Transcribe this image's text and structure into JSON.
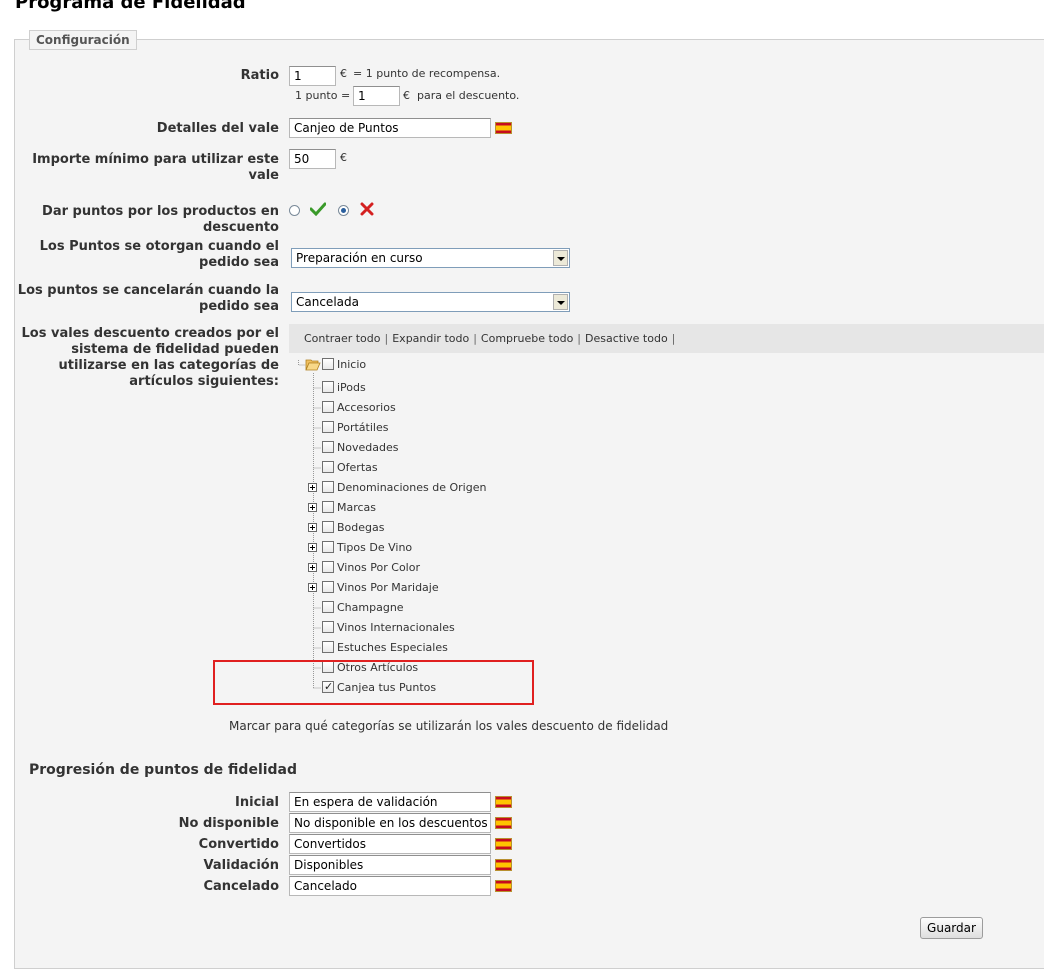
{
  "page_title": "Programa de Fidelidad",
  "config_legend": "Configuración",
  "ratio": {
    "label": "Ratio",
    "value": "1",
    "currency": "€",
    "suffix": "= 1 punto de recompensa.",
    "point_prefix": "1 punto =",
    "point_value": "1",
    "point_currency": "€",
    "point_suffix": "para el descuento."
  },
  "voucher_details": {
    "label": "Detalles del vale",
    "value": "Canjeo de Puntos"
  },
  "min_amount": {
    "label": "Importe mínimo para utilizar este vale",
    "value": "50",
    "currency": "€"
  },
  "discounted_products": {
    "label": "Dar puntos por los productos en descuento",
    "selected": "no"
  },
  "points_awarded": {
    "label": "Los Puntos se otorgan cuando el pedido sea",
    "selected": "Preparación en curso"
  },
  "points_cancelled": {
    "label": "Los puntos se cancelarán cuando la pedido sea",
    "selected": "Cancelada"
  },
  "categories": {
    "label": "Los vales descuento creados por el sistema de fidelidad pueden utilizarse en las categorías de artículos siguientes:",
    "toolbar": [
      "Contraer todo",
      "Expandir todo",
      "Compruebe todo",
      "Desactive todo"
    ],
    "root": "Inicio",
    "items": [
      {
        "label": "iPods",
        "expandable": false,
        "checked": false
      },
      {
        "label": "Accesorios",
        "expandable": false,
        "checked": false
      },
      {
        "label": "Portátiles",
        "expandable": false,
        "checked": false
      },
      {
        "label": "Novedades",
        "expandable": false,
        "checked": false
      },
      {
        "label": "Ofertas",
        "expandable": false,
        "checked": false
      },
      {
        "label": "Denominaciones de Origen",
        "expandable": true,
        "checked": false
      },
      {
        "label": "Marcas",
        "expandable": true,
        "checked": false
      },
      {
        "label": "Bodegas",
        "expandable": true,
        "checked": false
      },
      {
        "label": "Tipos De Vino",
        "expandable": true,
        "checked": false
      },
      {
        "label": "Vinos Por Color",
        "expandable": true,
        "checked": false
      },
      {
        "label": "Vinos Por Maridaje",
        "expandable": true,
        "checked": false
      },
      {
        "label": "Champagne",
        "expandable": false,
        "checked": false
      },
      {
        "label": "Vinos Internacionales",
        "expandable": false,
        "checked": false
      },
      {
        "label": "Estuches Especiales",
        "expandable": false,
        "checked": false
      },
      {
        "label": "Otros Artículos",
        "expandable": false,
        "checked": false
      },
      {
        "label": "Canjea tus Puntos",
        "expandable": false,
        "checked": true
      }
    ],
    "hint": "Marcar para qué categorías se utilizarán los vales descuento de fidelidad"
  },
  "progression": {
    "title": "Progresión de puntos de fidelidad",
    "rows": [
      {
        "label": "Inicial",
        "value": "En espera de validación"
      },
      {
        "label": "No disponible",
        "value": "No disponible en los descuentos"
      },
      {
        "label": "Convertido",
        "value": "Convertidos"
      },
      {
        "label": "Validación",
        "value": "Disponibles"
      },
      {
        "label": "Cancelado",
        "value": "Cancelado"
      }
    ]
  },
  "save_button": "Guardar",
  "colors": {
    "panel_bg": "#f4f4f4",
    "highlight": "#e02020",
    "check_green": "#3a9a2a",
    "cross_red": "#d42020"
  }
}
